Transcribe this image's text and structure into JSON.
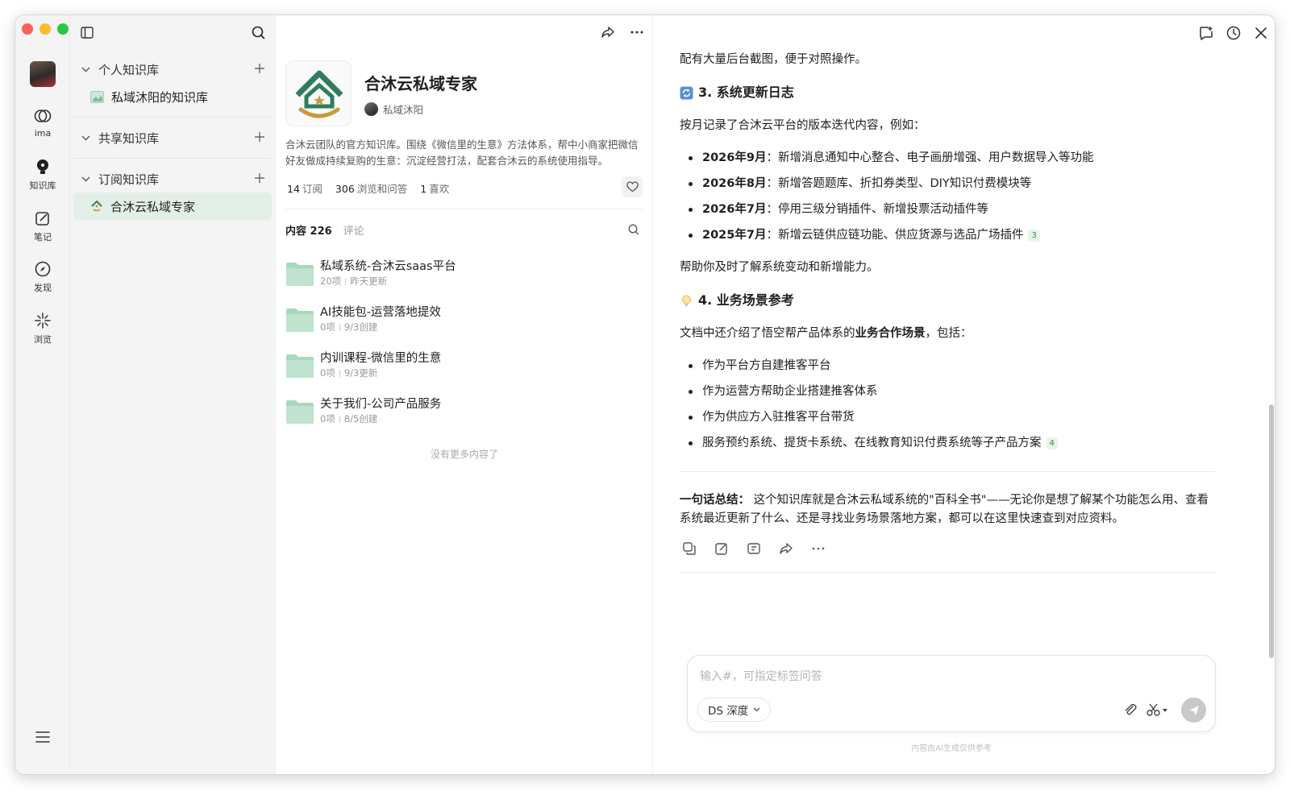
{
  "rail": {
    "items": [
      {
        "label": "ima",
        "icon": "ima-logo-icon"
      },
      {
        "label": "知识库",
        "icon": "knowledge-bulb-icon"
      },
      {
        "label": "笔记",
        "icon": "note-edit-icon"
      },
      {
        "label": "发现",
        "icon": "compass-icon"
      },
      {
        "label": "浏览",
        "icon": "sparkle-icon"
      }
    ]
  },
  "sidebar": {
    "sections": [
      {
        "label": "个人知识库"
      },
      {
        "label": "共享知识库"
      },
      {
        "label": "订阅知识库"
      }
    ],
    "personal_items": [
      {
        "label": "私域沐阳的知识库"
      }
    ],
    "subscribed_items": [
      {
        "label": "合沐云私域专家"
      }
    ]
  },
  "kb": {
    "title": "合沐云私域专家",
    "owner": "私域沐阳",
    "description": "合沐云团队的官方知识库。围绕《微信里的生意》方法体系，帮中小商家把微信好友做成持续复购的生意：沉淀经营打法，配套合沐云的系统使用指导。",
    "stats": [
      {
        "value": "14",
        "label": "订阅"
      },
      {
        "value": "306",
        "label": "浏览和问答"
      },
      {
        "value": "1",
        "label": "喜欢"
      }
    ],
    "tabs": {
      "content_label": "内容 226",
      "comments_label": "评论"
    },
    "folders": [
      {
        "name": "私域系统-合沐云saas平台",
        "count": "20项",
        "date": "昨天更新"
      },
      {
        "name": "AI技能包-运营落地提效",
        "count": "0项",
        "date": "9/3创建"
      },
      {
        "name": "内训课程-微信里的生意",
        "count": "0项",
        "date": "9/3更新"
      },
      {
        "name": "关于我们-公司产品服务",
        "count": "0项",
        "date": "8/5创建"
      }
    ],
    "no_more": "没有更多内容了"
  },
  "chat": {
    "intro_line": "配有大量后台截图，便于对照操作。",
    "section3": {
      "heading": "3. 系统更新日志",
      "lead": "按月记录了合沐云平台的版本迭代内容，例如：",
      "items": [
        {
          "date": "2026年9月",
          "text": "：新增消息通知中心整合、电子画册增强、用户数据导入等功能",
          "cite": ""
        },
        {
          "date": "2026年8月",
          "text": "：新增答题题库、折扣券类型、DIY知识付费模块等",
          "cite": ""
        },
        {
          "date": "2026年7月",
          "text": "：停用三级分销插件、新增投票活动插件等",
          "cite": ""
        },
        {
          "date": "2025年7月",
          "text": "：新增云链供应链功能、供应货源与选品广场插件",
          "cite": "3"
        }
      ],
      "outro": "帮助你及时了解系统变动和新增能力。"
    },
    "section4": {
      "heading": "4. 业务场景参考",
      "lead_before": "文档中还介绍了悟空帮产品体系的",
      "lead_bold": "业务合作场景",
      "lead_after": "，包括：",
      "items": [
        {
          "text": "作为平台方自建推客平台",
          "cite": ""
        },
        {
          "text": "作为运营方帮助企业搭建推客体系",
          "cite": ""
        },
        {
          "text": "作为供应方入驻推客平台带货",
          "cite": ""
        },
        {
          "text": "服务预约系统、提货卡系统、在线教育知识付费系统等子产品方案",
          "cite": "4"
        }
      ]
    },
    "summary_label": "一句话总结：",
    "summary_text": " 这个知识库就是合沐云私域系统的\"百科全书\"——无论你是想了解某个功能怎么用、查看系统最近更新了什么、还是寻找业务场景落地方案，都可以在这里快速查到对应资料。",
    "input_placeholder": "输入#，可指定标签问答",
    "model_label": "DS 深度",
    "footnote": "内容由AI生成仅供参考"
  },
  "colors": {
    "accent_green": "#2f7d5b",
    "active_bg": "#e2efe6",
    "folder_green": "#a8d8bd",
    "red": "#ff5f57",
    "yellow": "#febc2e",
    "green": "#28c840"
  }
}
